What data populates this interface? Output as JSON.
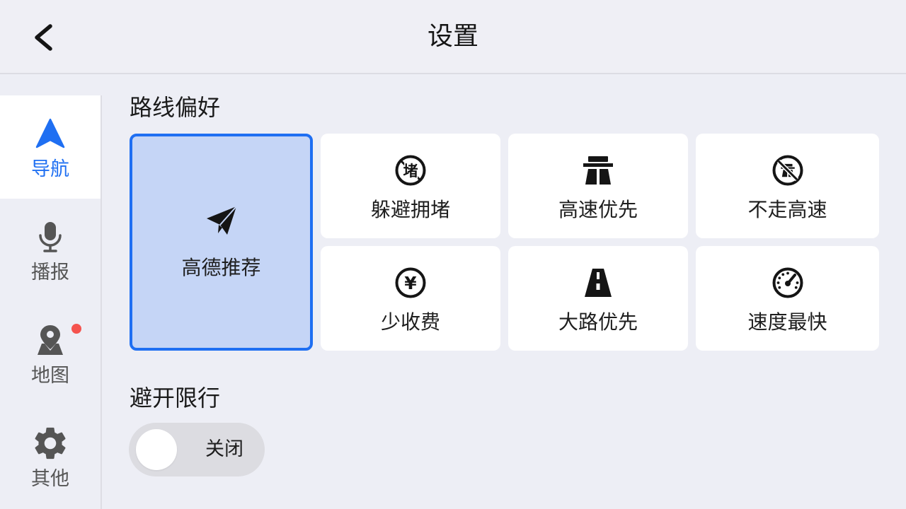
{
  "header": {
    "title": "设置",
    "back_icon": "chevron-left-icon"
  },
  "sidebar": {
    "items": [
      {
        "label": "导航",
        "icon": "navigation-arrow-icon",
        "selected": true,
        "badge": false
      },
      {
        "label": "播报",
        "icon": "microphone-icon",
        "selected": false,
        "badge": false
      },
      {
        "label": "地图",
        "icon": "map-pin-icon",
        "selected": false,
        "badge": true
      },
      {
        "label": "其他",
        "icon": "gear-icon",
        "selected": false,
        "badge": false
      }
    ]
  },
  "route_preference": {
    "title": "路线偏好",
    "options": [
      {
        "label": "高德推荐",
        "icon": "paper-plane-icon",
        "selected": true
      },
      {
        "label": "躲避拥堵",
        "icon": "avoid-congestion-icon",
        "icon_glyph": "堵",
        "selected": false
      },
      {
        "label": "高速优先",
        "icon": "highway-icon",
        "selected": false
      },
      {
        "label": "不走高速",
        "icon": "no-highway-icon",
        "selected": false
      },
      {
        "label": "少收费",
        "icon": "toll-fee-icon",
        "icon_glyph": "¥",
        "selected": false
      },
      {
        "label": "大路优先",
        "icon": "main-road-icon",
        "selected": false
      },
      {
        "label": "速度最快",
        "icon": "speedometer-icon",
        "selected": false
      }
    ]
  },
  "avoid_restriction": {
    "title": "避开限行",
    "toggle": {
      "on": false,
      "state_label": "关闭"
    }
  },
  "colors": {
    "accent": "#1F6FF2",
    "selected_fill": "#C5D5F6",
    "badge": "#F5534E",
    "background": "#EDEEF5"
  }
}
